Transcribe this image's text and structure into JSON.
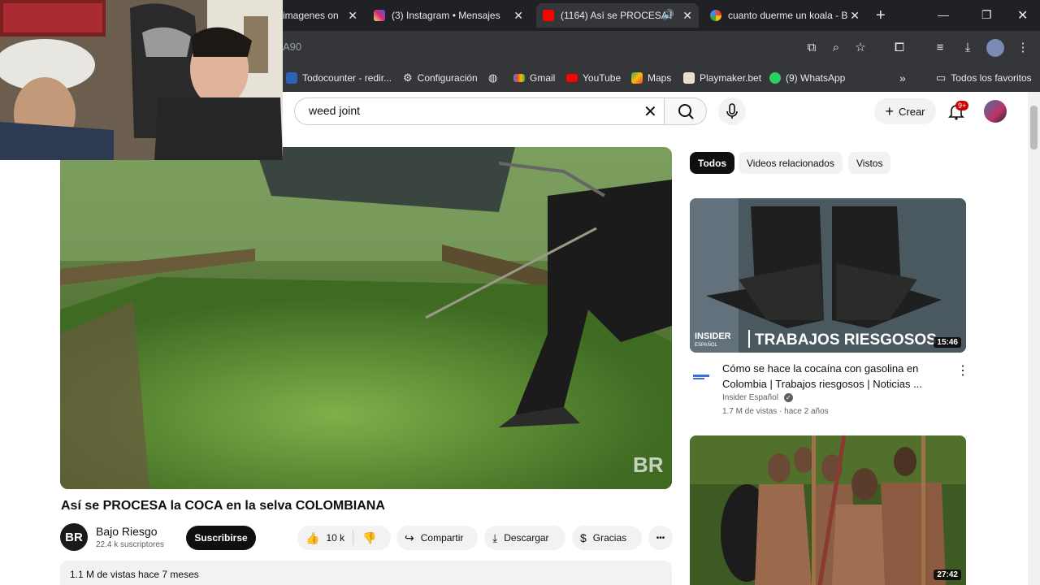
{
  "browser": {
    "tabs": [
      {
        "title": "imagenes on",
        "icon": "tab-page-icon"
      },
      {
        "title": "(3) Instagram • Mensajes",
        "icon": "instagram-icon"
      },
      {
        "title": "(1164) Así se PROCESA l",
        "icon": "youtube-icon",
        "active": true
      },
      {
        "title": "cuanto duerme un koala - B",
        "icon": "google-icon"
      }
    ],
    "new_tab_label": "+",
    "url_fragment": "A90",
    "bookmarks": [
      {
        "label": "Todocounter - redir...",
        "icon": "todocounter-icon"
      },
      {
        "label": "Configuración",
        "icon": "gear-icon"
      },
      {
        "label": "",
        "icon": "globe-icon"
      },
      {
        "label": "Gmail",
        "icon": "gmail-icon"
      },
      {
        "label": "YouTube",
        "icon": "youtube-icon"
      },
      {
        "label": "Maps",
        "icon": "maps-icon"
      },
      {
        "label": "Playmaker.bet",
        "icon": "playmaker-icon"
      },
      {
        "label": "(9) WhatsApp",
        "icon": "whatsapp-icon"
      }
    ],
    "more_bookmarks": "»",
    "all_bookmarks": "Todos los favoritos"
  },
  "youtube": {
    "search": {
      "value": "weed joint"
    },
    "create_label": "Crear",
    "notif_badge": "9+",
    "video": {
      "title": "Así se PROCESA la COCA en la selva COLOMBIANA",
      "watermark": "BR",
      "channel": {
        "avatar_text": "BR",
        "name": "Bajo Riesgo",
        "subscribers": "22.4 k suscriptores"
      },
      "subscribe_label": "Suscribirse",
      "likes": "10 k",
      "share_label": "Compartir",
      "download_label": "Descargar",
      "thanks_label": "Gracias",
      "more_label": "•••",
      "views": "1.1 M de vistas",
      "age": "hace 7 meses"
    },
    "chips": [
      "Todos",
      "Videos relacionados",
      "Vistos"
    ],
    "related": [
      {
        "title": "Cómo se hace la cocaína con gasolina en Colombia | Trabajos riesgosos | Noticias ...",
        "channel": "Insider Español",
        "verified": "✓",
        "views": "1.7 M de vistas",
        "age": "hace 2 años",
        "duration": "15:46",
        "thumb_brand": "INSIDER",
        "thumb_brand_sub": "ESPAÑOL",
        "thumb_text": "TRABAJOS RIESGOSOS"
      },
      {
        "duration": "27:42"
      }
    ]
  },
  "colors": {
    "youtube_red": "#ff0000",
    "chrome_dark": "#202124",
    "chrome_mid": "#35363a",
    "yt_text": "#0f0f0f"
  }
}
